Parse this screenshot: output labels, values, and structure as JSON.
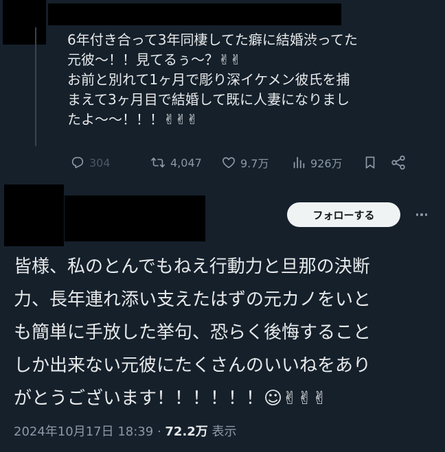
{
  "reply_tweet": {
    "text": "6年付き合って3年同棲してた癖に結婚渋ってた\n元彼〜！！見てるぅ〜？✌✌\nお前と別れて1ヶ月で彫り深イケメン彼氏を捕\nまえて3ヶ月目で結婚して既に人妻になりまし\nたよ〜〜！！！✌✌✌",
    "counts": {
      "replies": "304",
      "retweets": "4,047",
      "likes": "9.7万",
      "views": "926万"
    }
  },
  "main_tweet": {
    "follow_label": "フォローする",
    "text": "皆様、私のとんでもねえ行動力と旦那の決断\n力、長年連れ添い支えたはずの元カノをいと\nも簡単に手放した挙句、恐らく後悔すること\nしか出来ない元彼にたくさんのいいねをあり\nがとうございます！！！！！！☺✌✌✌",
    "timestamp": "2024年10月17日 18:39",
    "separator": " · ",
    "view_count": "72.2万",
    "view_label": " 表示"
  },
  "colors": {
    "background": "#15202b",
    "text": "#e7e9ea",
    "muted": "#8b98a5",
    "follow_bg": "#eff3f4"
  }
}
